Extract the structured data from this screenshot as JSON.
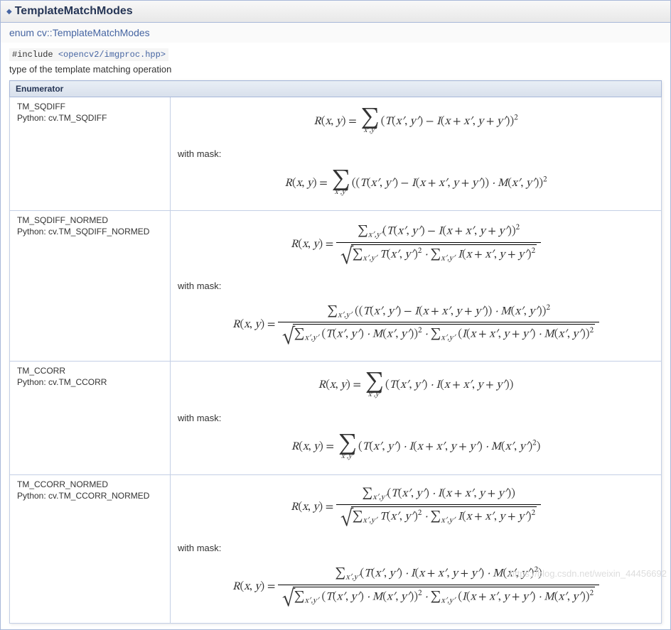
{
  "header": {
    "title": "TemplateMatchModes"
  },
  "enum_line": "enum cv::TemplateMatchModes",
  "include": {
    "prefix": "#include ",
    "path": "<opencv2/imgproc.hpp>"
  },
  "desc": "type of the template matching operation",
  "table_header": "Enumerator",
  "with_mask_label": "with mask:",
  "rows": [
    {
      "name": "TM_SQDIFF",
      "py": "Python: cv.TM_SQDIFF",
      "f1_html": "<span class='math'>R<span class='rm'>(</span>x<span class='rm'>,</span> y<span class='rm'>)</span> <span class='rm'>=</span> <span class='sum'><span class='big'>∑</span><span class='sub'>x′,y′</span></span><span class='rm'>(</span>T<span class='rm'>(</span>x′<span class='rm'>,</span> y′<span class='rm'>)</span> <span class='rm'>−</span> I<span class='rm'>(</span>x <span class='rm'>+</span> x′<span class='rm'>,</span> y <span class='rm'>+</span> y′<span class='rm'>))</span><sup><span class='rm'>2</span></sup></span>",
      "f2_html": "<span class='math'>R<span class='rm'>(</span>x<span class='rm'>,</span> y<span class='rm'>)</span> <span class='rm'>=</span> <span class='sum'><span class='big'>∑</span><span class='sub'>x′,y′</span></span><span class='rm'>((</span>T<span class='rm'>(</span>x′<span class='rm'>,</span> y′<span class='rm'>)</span> <span class='rm'>−</span> I<span class='rm'>(</span>x <span class='rm'>+</span> x′<span class='rm'>,</span> y <span class='rm'>+</span> y′<span class='rm'>))</span> · M<span class='rm'>(</span>x′<span class='rm'>,</span> y′<span class='rm'>))</span><sup><span class='rm'>2</span></sup></span>"
    },
    {
      "name": "TM_SQDIFF_NORMED",
      "py": "Python: cv.TM_SQDIFF_NORMED",
      "f1_html": "<span class='math'>R<span class='rm'>(</span>x<span class='rm'>,</span> y<span class='rm'>)</span> <span class='rm'>=</span> <span class='frac'><span class='num'><span class='rm'>∑</span><sub>x′,y′</sub><span class='rm'>(</span>T<span class='rm'>(</span>x′<span class='rm'>,</span> y′<span class='rm'>)</span> <span class='rm'>−</span> I<span class='rm'>(</span>x <span class='rm'>+</span> x′<span class='rm'>,</span> y <span class='rm'>+</span> y′<span class='rm'>))</span><sup><span class='rm'>2</span></sup></span><span class='den'><span class='sqrt'><span class='radicand'><span class='rm'>∑</span><sub>x′,y′</sub> T<span class='rm'>(</span>x′<span class='rm'>,</span> y′<span class='rm'>)</span><sup><span class='rm'>2</span></sup> · <span class='rm'>∑</span><sub>x′,y′</sub> I<span class='rm'>(</span>x <span class='rm'>+</span> x′<span class='rm'>,</span> y <span class='rm'>+</span> y′<span class='rm'>)</span><sup><span class='rm'>2</span></sup></span></span></span></span></span>",
      "f2_html": "<span class='math'>R<span class='rm'>(</span>x<span class='rm'>,</span> y<span class='rm'>)</span> <span class='rm'>=</span> <span class='frac'><span class='num'><span class='rm'>∑</span><sub>x′,y′</sub> <span class='rm'>((</span>T<span class='rm'>(</span>x′<span class='rm'>,</span> y′<span class='rm'>)</span> <span class='rm'>−</span> I<span class='rm'>(</span>x <span class='rm'>+</span> x′<span class='rm'>,</span> y <span class='rm'>+</span> y′<span class='rm'>))</span> · M<span class='rm'>(</span>x′<span class='rm'>,</span> y′<span class='rm'>))</span><sup><span class='rm'>2</span></sup></span><span class='den'><span class='sqrt'><span class='radicand'><span class='rm'>∑</span><sub>x′,y′</sub> <span class='rm'>(</span>T<span class='rm'>(</span>x′<span class='rm'>,</span> y′<span class='rm'>)</span> · M<span class='rm'>(</span>x′<span class='rm'>,</span> y′<span class='rm'>))</span><sup><span class='rm'>2</span></sup> · <span class='rm'>∑</span><sub>x′,y′</sub> <span class='rm'>(</span>I<span class='rm'>(</span>x <span class='rm'>+</span> x′<span class='rm'>,</span> y <span class='rm'>+</span> y′<span class='rm'>)</span> · M<span class='rm'>(</span>x′<span class='rm'>,</span> y′<span class='rm'>))</span><sup><span class='rm'>2</span></sup></span></span></span></span></span>"
    },
    {
      "name": "TM_CCORR",
      "py": "Python: cv.TM_CCORR",
      "f1_html": "<span class='math'>R<span class='rm'>(</span>x<span class='rm'>,</span> y<span class='rm'>)</span> <span class='rm'>=</span> <span class='sum'><span class='big'>∑</span><span class='sub'>x′,y′</span></span><span class='rm'>(</span>T<span class='rm'>(</span>x′<span class='rm'>,</span> y′<span class='rm'>)</span> · I<span class='rm'>(</span>x <span class='rm'>+</span> x′<span class='rm'>,</span> y <span class='rm'>+</span> y′<span class='rm'>))</span></span>",
      "f2_html": "<span class='math'>R<span class='rm'>(</span>x<span class='rm'>,</span> y<span class='rm'>)</span> <span class='rm'>=</span> <span class='sum'><span class='big'>∑</span><span class='sub'>x′,y′</span></span><span class='rm'>(</span>T<span class='rm'>(</span>x′<span class='rm'>,</span> y′<span class='rm'>)</span> · I<span class='rm'>(</span>x <span class='rm'>+</span> x′<span class='rm'>,</span> y <span class='rm'>+</span> y′<span class='rm'>)</span> · M<span class='rm'>(</span>x′<span class='rm'>,</span> y′<span class='rm'>)</span><sup><span class='rm'>2</span></sup><span class='rm'>)</span></span>"
    },
    {
      "name": "TM_CCORR_NORMED",
      "py": "Python: cv.TM_CCORR_NORMED",
      "f1_html": "<span class='math'>R<span class='rm'>(</span>x<span class='rm'>,</span> y<span class='rm'>)</span> <span class='rm'>=</span> <span class='frac'><span class='num'><span class='rm'>∑</span><sub>x′,y′</sub><span class='rm'>(</span>T<span class='rm'>(</span>x′<span class='rm'>,</span> y′<span class='rm'>)</span> · I<span class='rm'>(</span>x <span class='rm'>+</span> x′<span class='rm'>,</span> y <span class='rm'>+</span> y′<span class='rm'>))</span></span><span class='den'><span class='sqrt'><span class='radicand'><span class='rm'>∑</span><sub>x′,y′</sub> T<span class='rm'>(</span>x′<span class='rm'>,</span> y′<span class='rm'>)</span><sup><span class='rm'>2</span></sup> · <span class='rm'>∑</span><sub>x′,y′</sub> I<span class='rm'>(</span>x <span class='rm'>+</span> x′<span class='rm'>,</span> y <span class='rm'>+</span> y′<span class='rm'>)</span><sup><span class='rm'>2</span></sup></span></span></span></span></span>",
      "f2_html": "<span class='math'>R<span class='rm'>(</span>x<span class='rm'>,</span> y<span class='rm'>)</span> <span class='rm'>=</span> <span class='frac'><span class='num'><span class='rm'>∑</span><sub>x′,y′</sub><span class='rm'>(</span>T<span class='rm'>(</span>x′<span class='rm'>,</span> y′<span class='rm'>)</span> · I<span class='rm'>(</span>x <span class='rm'>+</span> x′<span class='rm'>,</span> y <span class='rm'>+</span> y′<span class='rm'>)</span> · M<span class='rm'>(</span>x′<span class='rm'>,</span> y′<span class='rm'>)</span><sup><span class='rm'>2</span></sup><span class='rm'>)</span></span><span class='den'><span class='sqrt'><span class='radicand'><span class='rm'>∑</span><sub>x′,y′</sub> <span class='rm'>(</span>T<span class='rm'>(</span>x′<span class='rm'>,</span> y′<span class='rm'>)</span> · M<span class='rm'>(</span>x′<span class='rm'>,</span> y′<span class='rm'>))</span><sup><span class='rm'>2</span></sup> · <span class='rm'>∑</span><sub>x′,y′</sub> <span class='rm'>(</span>I<span class='rm'>(</span>x <span class='rm'>+</span> x′<span class='rm'>,</span> y <span class='rm'>+</span> y′<span class='rm'>)</span> · M<span class='rm'>(</span>x′<span class='rm'>,</span> y′<span class='rm'>))</span><sup><span class='rm'>2</span></sup></span></span></span></span></span>"
    }
  ],
  "watermark": "https://blog.csdn.net/weixin_44456692"
}
